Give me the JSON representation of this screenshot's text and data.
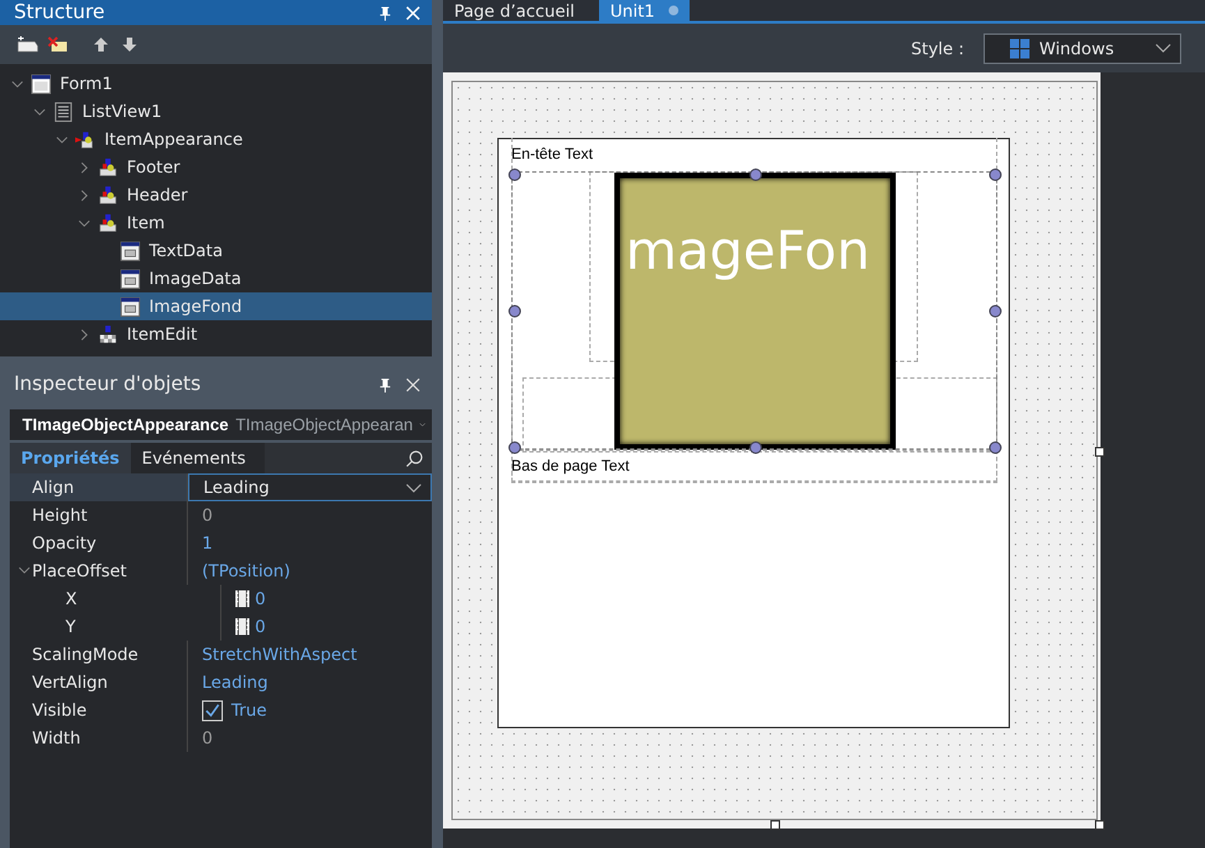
{
  "structure": {
    "title": "Structure",
    "tree": [
      {
        "label": "Form1",
        "kind": "form",
        "expanded": true,
        "selected": false,
        "children": [
          {
            "label": "ListView1",
            "kind": "list",
            "expanded": true,
            "selected": false,
            "children": [
              {
                "label": "ItemAppearance",
                "kind": "appearance",
                "expanded": true,
                "selected": false,
                "children": [
                  {
                    "label": "Footer",
                    "kind": "object",
                    "expanded": false,
                    "selected": false
                  },
                  {
                    "label": "Header",
                    "kind": "object",
                    "expanded": false,
                    "selected": false
                  },
                  {
                    "label": "Item",
                    "kind": "object",
                    "expanded": true,
                    "selected": false,
                    "children": [
                      {
                        "label": "TextData",
                        "kind": "window",
                        "selected": false
                      },
                      {
                        "label": "ImageData",
                        "kind": "window",
                        "selected": false
                      },
                      {
                        "label": "ImageFond",
                        "kind": "window",
                        "selected": true
                      }
                    ]
                  },
                  {
                    "label": "ItemEdit",
                    "kind": "edit",
                    "expanded": false,
                    "selected": false
                  }
                ]
              }
            ]
          }
        ]
      }
    ]
  },
  "inspector": {
    "title": "Inspecteur d'objets",
    "object_name": "TImageObjectAppearance",
    "object_type": "TImageObjectAppearan",
    "tabs": [
      {
        "label": "Propriétés",
        "selected": true
      },
      {
        "label": "Evénements",
        "selected": false
      }
    ],
    "properties": [
      {
        "name": "Align",
        "value": "Leading",
        "kind": "dropdown",
        "modified": false,
        "selected": true
      },
      {
        "name": "Height",
        "value": "0",
        "kind": "text",
        "modified": false,
        "selected": false
      },
      {
        "name": "Opacity",
        "value": "1",
        "kind": "text",
        "modified": true,
        "selected": false
      },
      {
        "name": "PlaceOffset",
        "value": "(TPosition)",
        "kind": "text",
        "modified": true,
        "selected": false,
        "expanded": true,
        "children": [
          {
            "name": "X",
            "value": "0",
            "kind": "number",
            "modified": true,
            "selected": false
          },
          {
            "name": "Y",
            "value": "0",
            "kind": "number",
            "modified": true,
            "selected": false
          }
        ]
      },
      {
        "name": "ScalingMode",
        "value": "StretchWithAspect",
        "kind": "text",
        "modified": true,
        "selected": false
      },
      {
        "name": "VertAlign",
        "value": "Leading",
        "kind": "text",
        "modified": true,
        "selected": false
      },
      {
        "name": "Visible",
        "value": "True",
        "kind": "checkbox",
        "checked": true,
        "modified": true,
        "selected": false
      },
      {
        "name": "Width",
        "value": "0",
        "kind": "text",
        "modified": false,
        "selected": false
      }
    ]
  },
  "editor": {
    "tabs": [
      {
        "label": "Page d’accueil",
        "selected": false,
        "modified": false
      },
      {
        "label": "Unit1",
        "selected": true,
        "modified": true
      }
    ],
    "style_label": "Style :",
    "style_value": "Windows",
    "designer": {
      "header_text": "En-tête Text",
      "footer_text": "Bas de page Text",
      "image_caption": "mageFon"
    }
  }
}
